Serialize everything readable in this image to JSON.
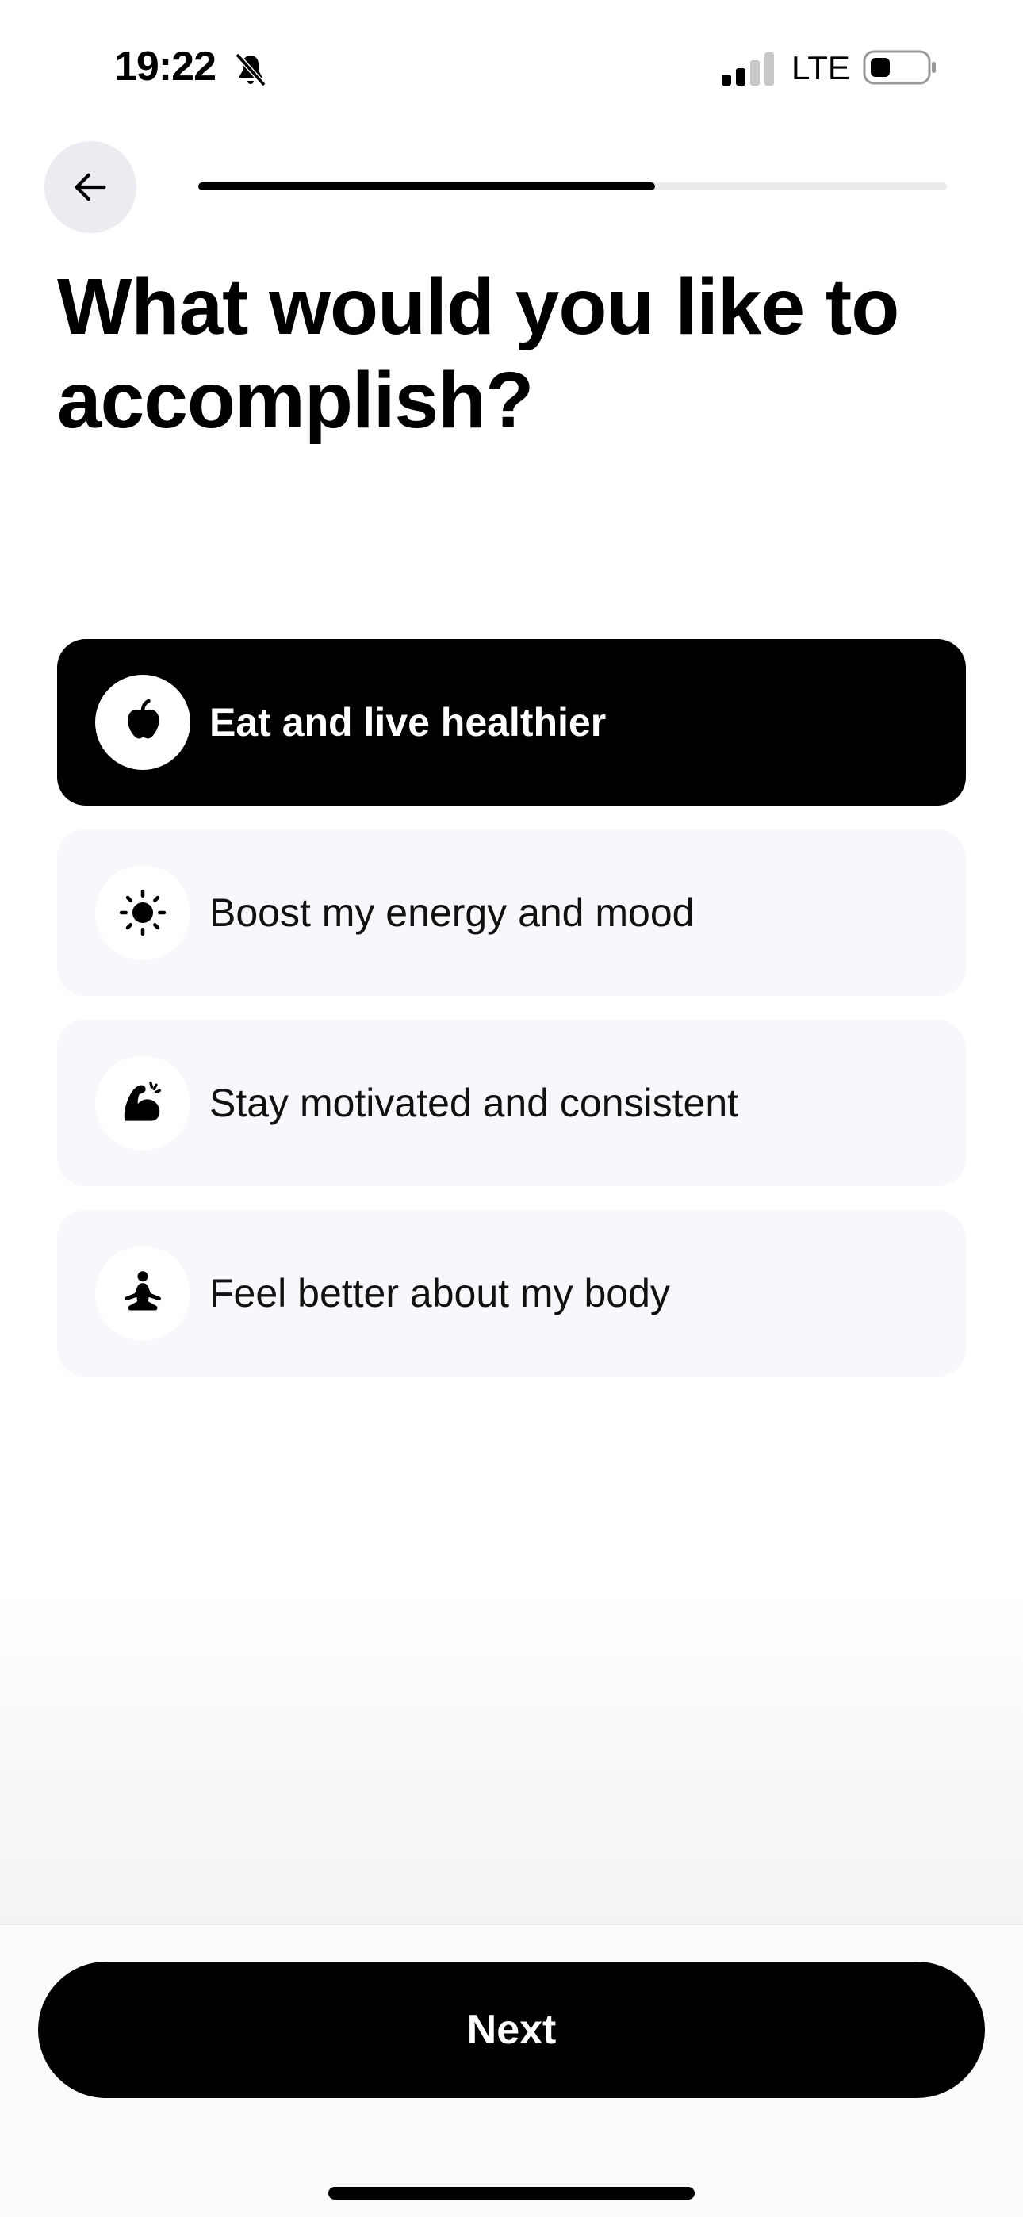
{
  "status_bar": {
    "time": "19:22",
    "network": "LTE",
    "icons": [
      "bell-slash-icon",
      "signal-icon",
      "battery-icon"
    ]
  },
  "header": {
    "back_icon": "arrow-left-icon",
    "progress": 0.61
  },
  "title": "What would you like to accomplish?",
  "options": [
    {
      "label": "Eat and live healthier",
      "icon": "apple-icon",
      "selected": true
    },
    {
      "label": "Boost my energy and mood",
      "icon": "sun-icon",
      "selected": false
    },
    {
      "label": "Stay motivated and consistent",
      "icon": "flexed-bicep-icon",
      "selected": false
    },
    {
      "label": "Feel better about my body",
      "icon": "meditation-icon",
      "selected": false
    }
  ],
  "footer": {
    "next_label": "Next"
  },
  "colors": {
    "primary": "#000000",
    "option_background": "#f7f7fc",
    "back_button_background": "#ecebf1",
    "progress_track": "#ebebeb"
  }
}
